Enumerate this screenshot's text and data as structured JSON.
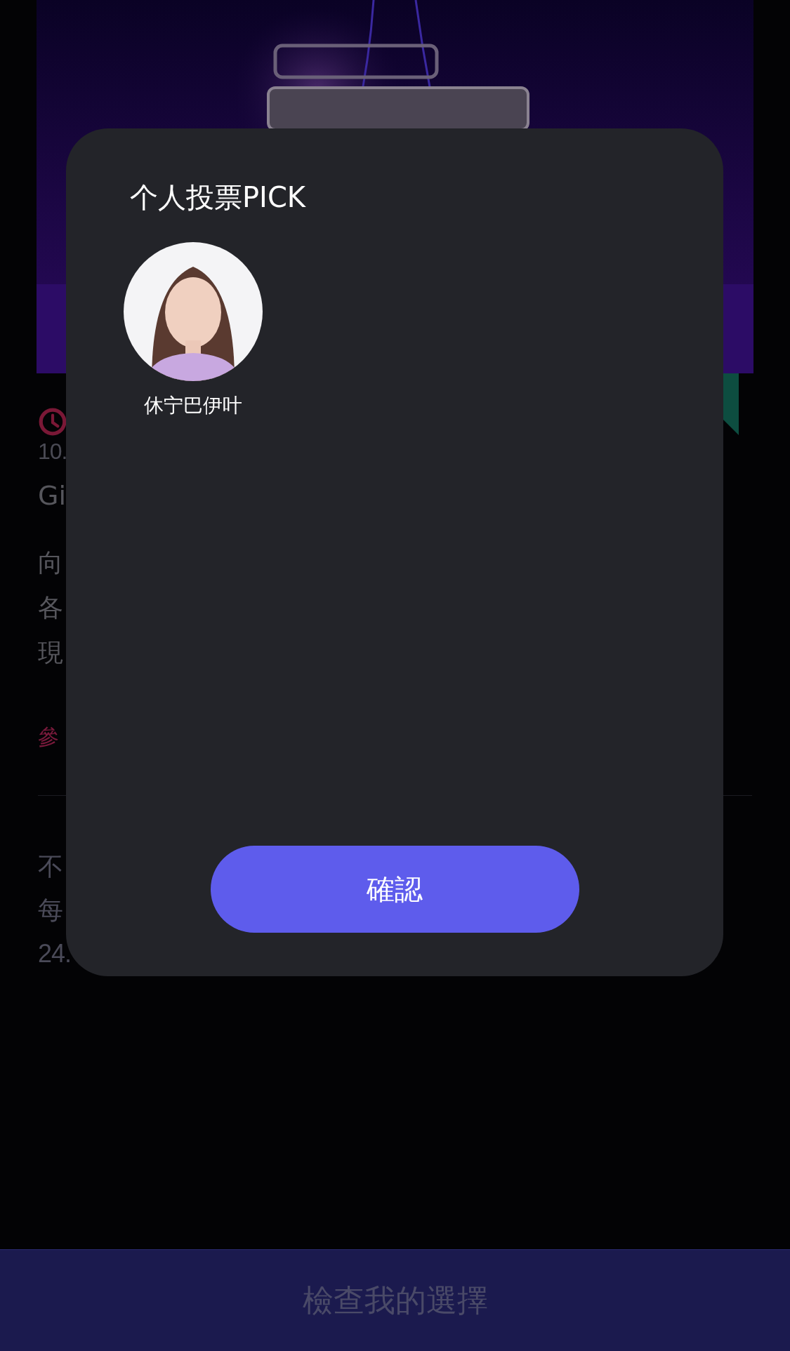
{
  "page": {
    "time": "10.",
    "title": "Gi",
    "description": [
      "向",
      "各",
      "現"
    ],
    "link": "參",
    "notes": [
      "不",
      "每",
      "24."
    ],
    "bottom_button": "檢查我的選擇"
  },
  "dialog": {
    "title": "个人投票PICK",
    "picks": [
      {
        "name": "休宁巴伊叶"
      }
    ],
    "confirm_button": "確認"
  }
}
